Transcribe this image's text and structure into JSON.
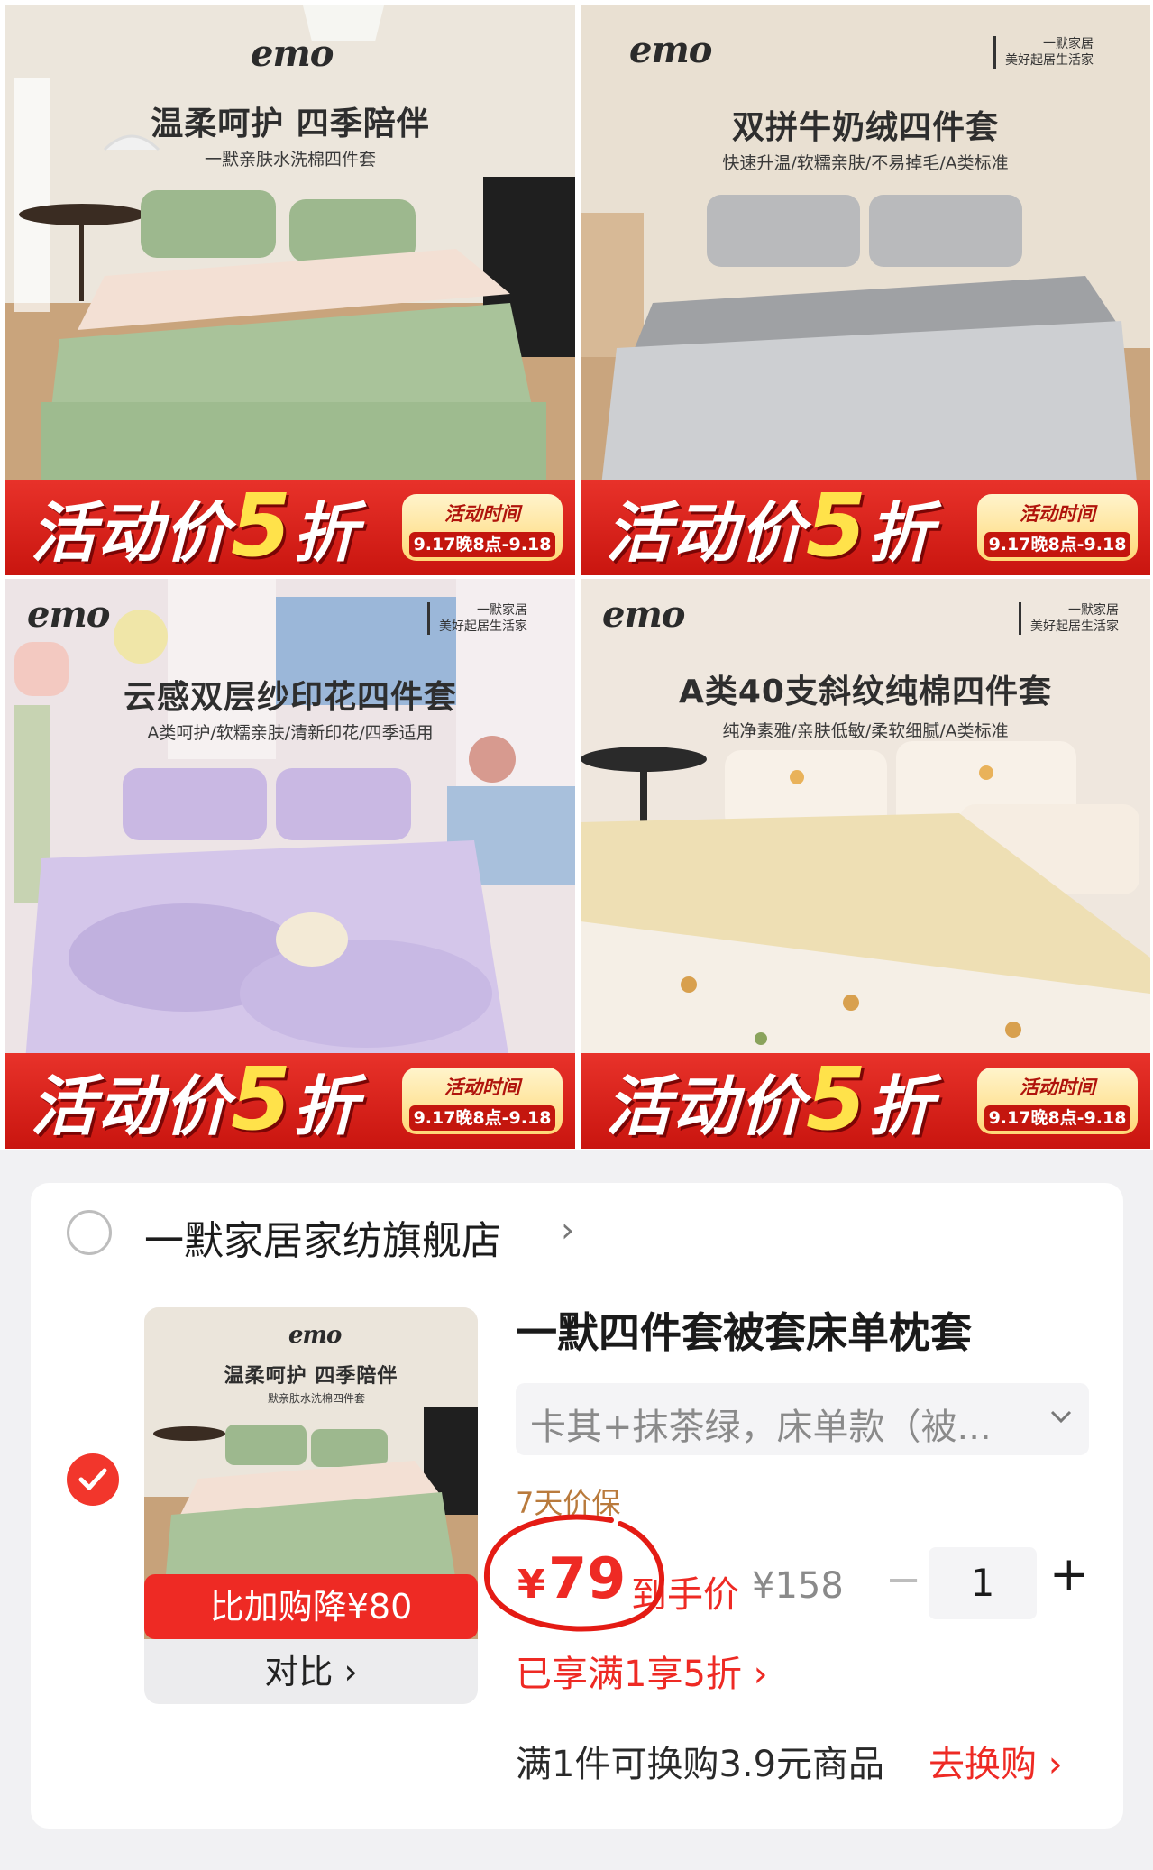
{
  "products": [
    {
      "brand": "emo",
      "headline": "温柔呵护 四季陪伴",
      "subline": "一默亲肤水洗棉四件套",
      "tagline": [],
      "promo": {
        "prefix": "活动价",
        "number": "5",
        "suffix": "折",
        "time_label": "活动时间",
        "time_range": "9.17晚8点-9.18"
      }
    },
    {
      "brand": "emo",
      "headline": "双拼牛奶绒四件套",
      "subline": "快速升温/软糯亲肤/不易掉毛/A类标准",
      "tagline": [
        "一默家居",
        "美好起居生活家"
      ],
      "promo": {
        "prefix": "活动价",
        "number": "5",
        "suffix": "折",
        "time_label": "活动时间",
        "time_range": "9.17晚8点-9.18"
      }
    },
    {
      "brand": "emo",
      "headline": "云感双层纱印花四件套",
      "subline": "A类呵护/软糯亲肤/清新印花/四季适用",
      "tagline": [
        "一默家居",
        "美好起居生活家"
      ],
      "promo": {
        "prefix": "活动价",
        "number": "5",
        "suffix": "折",
        "time_label": "活动时间",
        "time_range": "9.17晚8点-9.18"
      }
    },
    {
      "brand": "emo",
      "headline": "A类40支斜纹纯棉四件套",
      "subline": "纯净素雅/亲肤低敏/柔软细腻/A类标准",
      "tagline": [
        "一默家居",
        "美好起居生活家"
      ],
      "promo": {
        "prefix": "活动价",
        "number": "5",
        "suffix": "折",
        "time_label": "活动时间",
        "time_range": "9.17晚8点-9.18"
      }
    }
  ],
  "cart": {
    "store_name": "一默家居家纺旗舰店",
    "item": {
      "thumb_brand": "emo",
      "thumb_headline": "温柔呵护 四季陪伴",
      "thumb_subline": "一默亲肤水洗棉四件套",
      "thumb_badge": "比加购降¥80",
      "compare_label": "对比 ›",
      "title": "一默四件套被套床单枕套",
      "sku": "卡其+抹茶绿，床单款（被...",
      "guarantee": "7天价保",
      "price_symbol": "¥",
      "price": "79",
      "price_label": "到手价",
      "original_price": "¥158",
      "quantity": "1",
      "qty_minus": "−",
      "qty_plus": "+",
      "discount": "已享满1享5折 ›"
    },
    "swap_text": "满1件可换购3.9元商品",
    "swap_link": "去换购 ›"
  },
  "colors": {
    "accent_red": "#ee2a24",
    "promo_yellow": "#ffe24a",
    "annotation_red": "#e41b14"
  }
}
